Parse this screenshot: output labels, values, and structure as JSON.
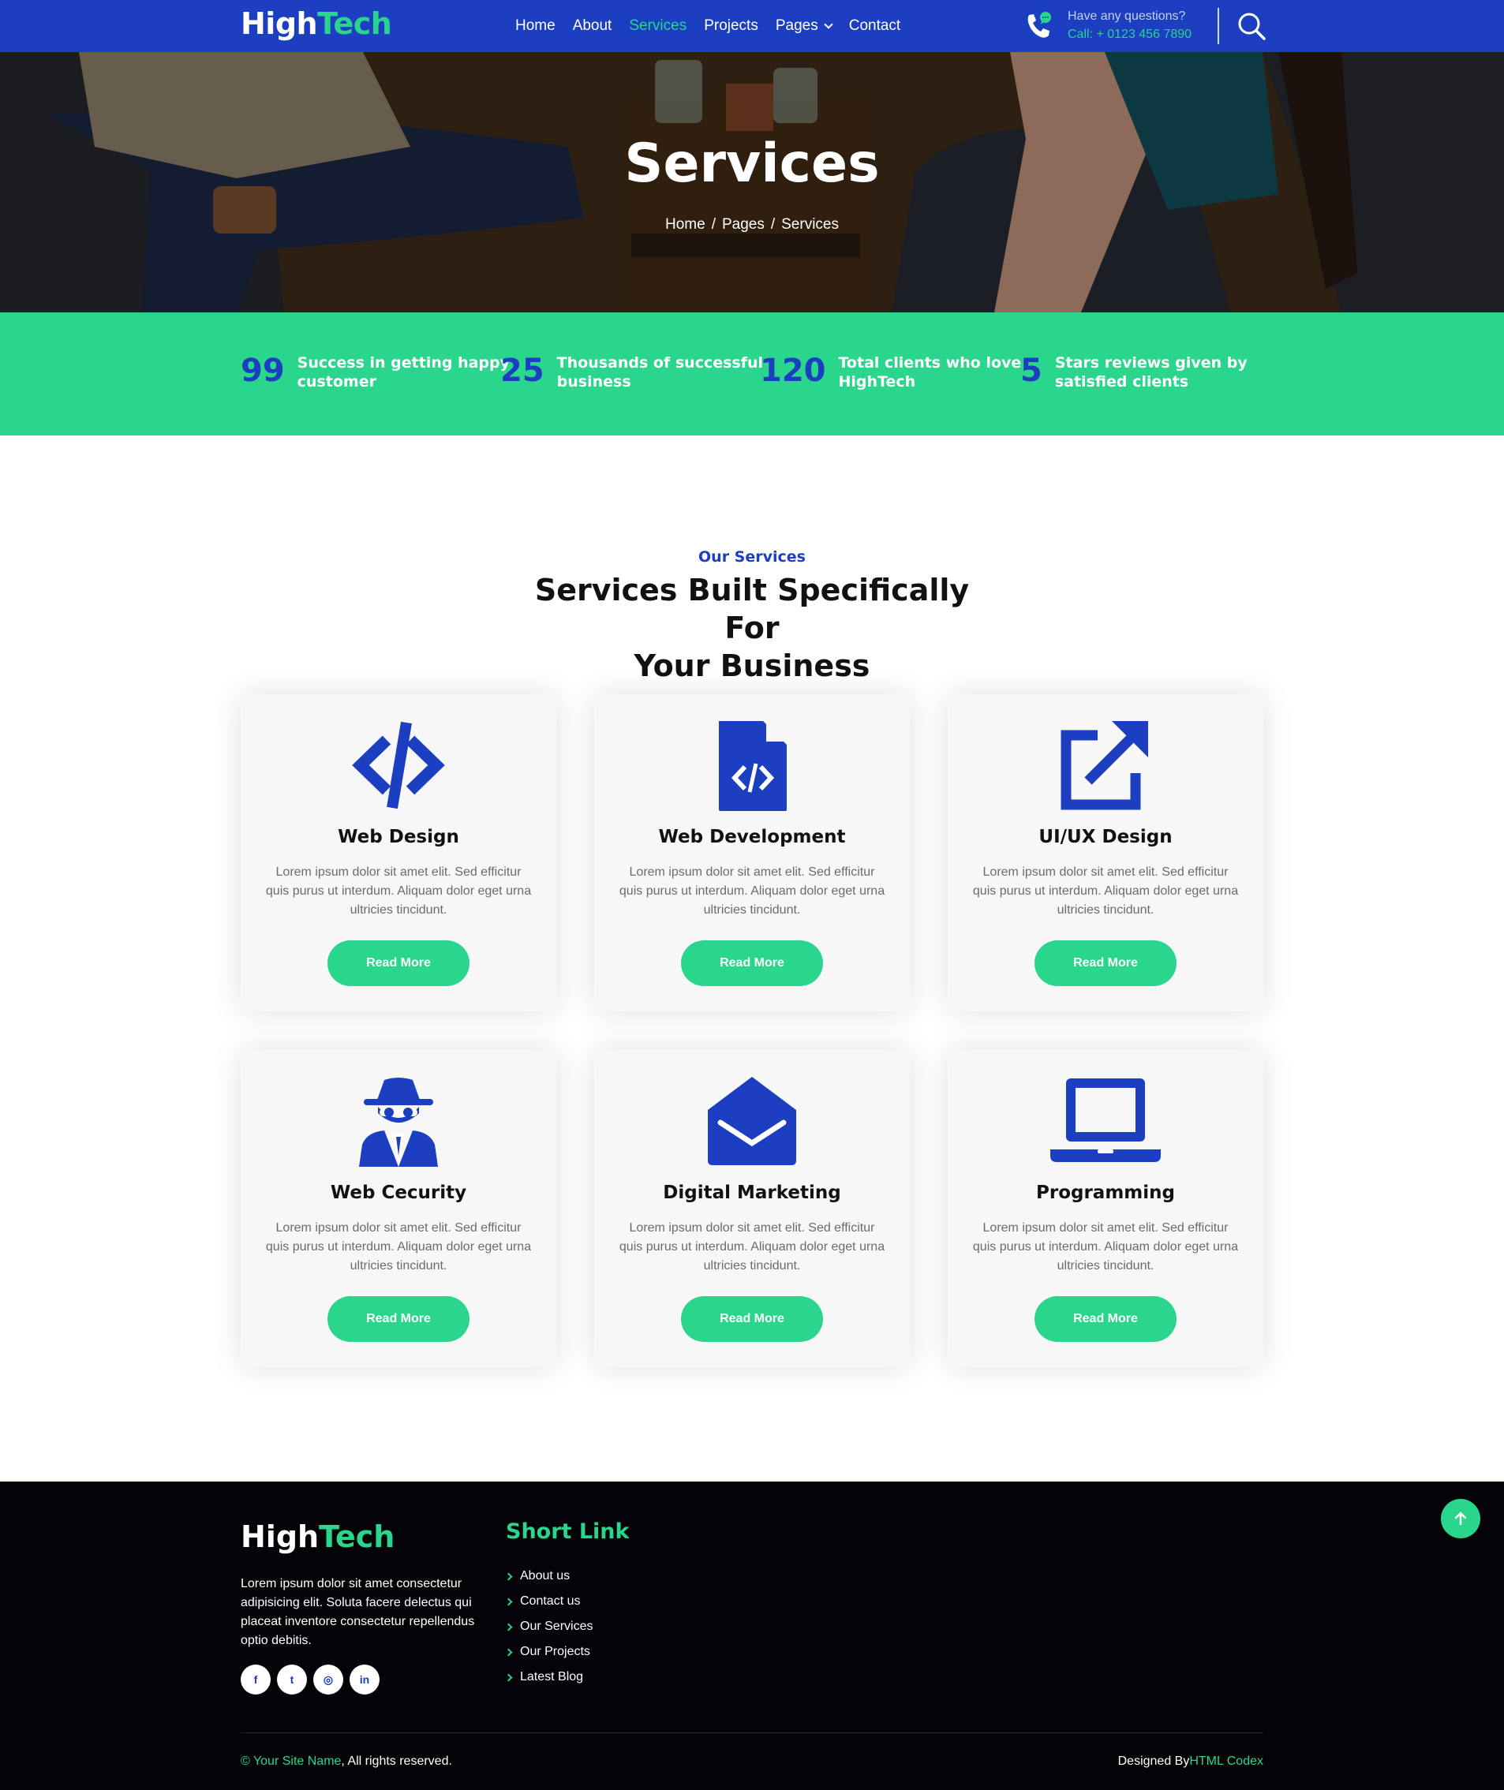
{
  "colors": {
    "primary": "#1b3fc0",
    "accent": "#29d68c",
    "footer_bg": "#040408"
  },
  "brand": {
    "part1": "High",
    "part2": "Tech"
  },
  "nav": {
    "items": [
      {
        "label": "Home"
      },
      {
        "label": "About"
      },
      {
        "label": "Services",
        "active": true
      },
      {
        "label": "Projects"
      },
      {
        "label": "Pages",
        "dropdown": true
      },
      {
        "label": "Contact"
      }
    ],
    "contact_question": "Have any questions?",
    "contact_phone": "Call: + 0123 456 7890",
    "phone_icon": "phone-chat-icon",
    "search_icon": "search-icon"
  },
  "hero": {
    "title": "Services",
    "breadcrumb": [
      "Home",
      "Pages",
      "Services"
    ],
    "separator": "/"
  },
  "stats": [
    {
      "number": "99",
      "text_line1": "Success in getting happy",
      "text_line2": "customer"
    },
    {
      "number": "25",
      "text_line1": "Thousands of successful",
      "text_line2": "business"
    },
    {
      "number": "120",
      "text_line1": "Total clients who love",
      "text_line2": "HighTech"
    },
    {
      "number": "5",
      "text_line1": "Stars reviews given by",
      "text_line2": "satisfied clients"
    }
  ],
  "services": {
    "subtitle": "Our Services",
    "title_line1": "Services Built Specifically For",
    "title_line2": "Your Business",
    "cards": [
      {
        "icon": "code-icon",
        "title": "Web Design",
        "desc": "Lorem ipsum dolor sit amet elit. Sed efficitur quis purus ut interdum. Aliquam dolor eget urna ultricies tincidunt.",
        "button": "Read More"
      },
      {
        "icon": "file-code-icon",
        "title": "Web Development",
        "desc": "Lorem ipsum dolor sit amet elit. Sed efficitur quis purus ut interdum. Aliquam dolor eget urna ultricies tincidunt.",
        "button": "Read More"
      },
      {
        "icon": "external-link-icon",
        "title": "UI/UX Design",
        "desc": "Lorem ipsum dolor sit amet elit. Sed efficitur quis purus ut interdum. Aliquam dolor eget urna ultricies tincidunt.",
        "button": "Read More"
      },
      {
        "icon": "spy-icon",
        "title": "Web Cecurity",
        "desc": "Lorem ipsum dolor sit amet elit. Sed efficitur quis purus ut interdum. Aliquam dolor eget urna ultricies tincidunt.",
        "button": "Read More"
      },
      {
        "icon": "envelope-open-icon",
        "title": "Digital Marketing",
        "desc": "Lorem ipsum dolor sit amet elit. Sed efficitur quis purus ut interdum. Aliquam dolor eget urna ultricies tincidunt.",
        "button": "Read More"
      },
      {
        "icon": "laptop-icon",
        "title": "Programming",
        "desc": "Lorem ipsum dolor sit amet elit. Sed efficitur quis purus ut interdum. Aliquam dolor eget urna ultricies tincidunt.",
        "button": "Read More"
      }
    ]
  },
  "footer": {
    "desc": "Lorem ipsum dolor sit amet consectetur adipisicing elit. Soluta facere delectus qui placeat inventore consectetur repellendus optio debitis.",
    "socials": [
      {
        "icon": "facebook-icon",
        "glyph": "f"
      },
      {
        "icon": "twitter-icon",
        "glyph": "t"
      },
      {
        "icon": "instagram-icon",
        "glyph": "◎"
      },
      {
        "icon": "linkedin-icon",
        "glyph": "in"
      }
    ],
    "short_link_heading": "Short Link",
    "links": [
      "About us",
      "Contact us",
      "Our Services",
      "Our Projects",
      "Latest Blog"
    ],
    "copyright_site": "© Your Site Name",
    "copyright_rest": ", All rights reserved.",
    "designed_by_label": "Designed By",
    "designed_by_name": "HTML Codex",
    "back_to_top_icon": "arrow-up-icon"
  }
}
